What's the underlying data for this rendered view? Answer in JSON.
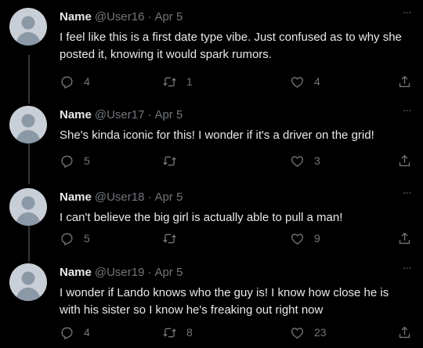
{
  "tweets": [
    {
      "name": "Name",
      "handle": "@User16",
      "dot": "·",
      "date": "Apr 5",
      "text": "I feel like this is a first date type vibe. Just confused as to why she posted it, knowing it would spark rumors.",
      "replies": "4",
      "retweets": "1",
      "likes": "4"
    },
    {
      "name": "Name",
      "handle": "@User17",
      "dot": "·",
      "date": "Apr 5",
      "text": "She's kinda iconic for this! I wonder if it's a driver on the grid!",
      "replies": "5",
      "retweets": "",
      "likes": "3"
    },
    {
      "name": "Name",
      "handle": "@User18",
      "dot": "·",
      "date": "Apr 5",
      "text": "I can't believe the big girl is actually able to pull a man!",
      "replies": "5",
      "retweets": "",
      "likes": "9"
    },
    {
      "name": "Name",
      "handle": "@User19",
      "dot": "·",
      "date": "Apr 5",
      "text": "I wonder if Lando knows who the guy is! I know how close he is with his sister so I know he's freaking out right now",
      "replies": "4",
      "retweets": "8",
      "likes": "23"
    }
  ],
  "more_glyph": "···",
  "icons": [
    "reply-icon",
    "retweet-icon",
    "like-icon",
    "share-icon",
    "more-icon",
    "default-avatar-icon"
  ],
  "colors": {
    "background": "#000000",
    "text": "#e7e9ea",
    "secondary": "#71767b",
    "avatar": "#c9cfd6",
    "avatar_figure": "#8b98a5",
    "thread_line": "#333639"
  }
}
